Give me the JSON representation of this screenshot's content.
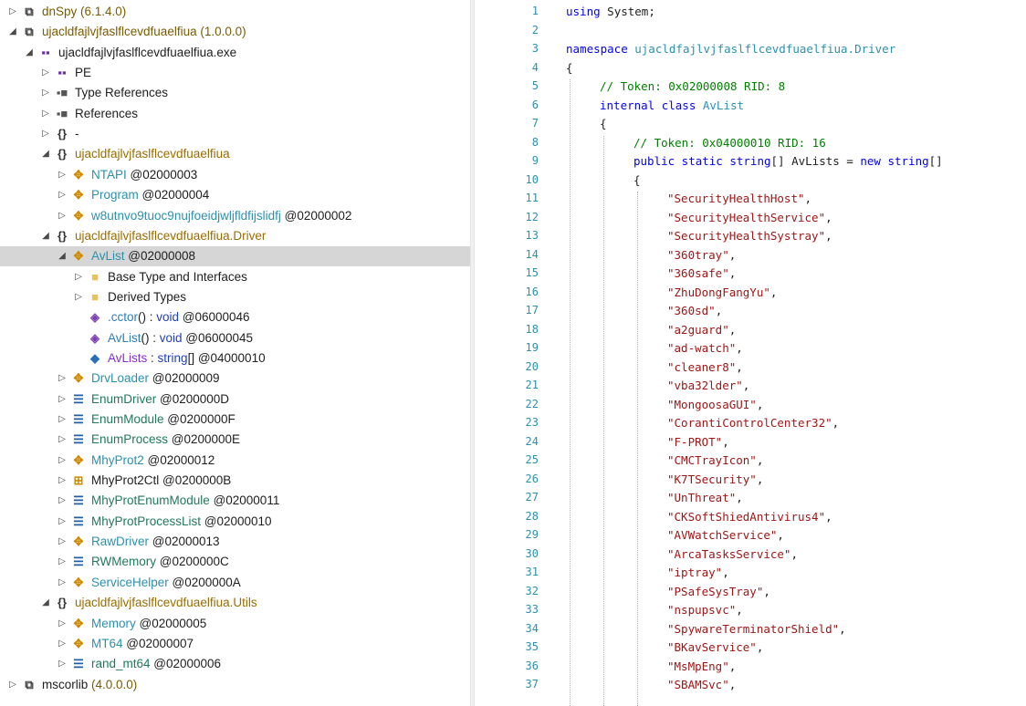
{
  "tree": {
    "nodes": [
      {
        "depth": 0,
        "exp": "collapsed",
        "icon": "assembly-icon",
        "glyph": "⧉",
        "icolor": "#3a3a3a",
        "parts": [
          {
            "t": "dnSpy",
            "c": "c-asm"
          },
          {
            "t": " (6.1.4.0)",
            "c": "c-ver"
          }
        ]
      },
      {
        "depth": 0,
        "exp": "expanded",
        "icon": "assembly-icon",
        "glyph": "⧉",
        "icolor": "#3a3a3a",
        "parts": [
          {
            "t": "ujacldfajlvjfaslflcevdfuaelfiua",
            "c": "c-asm"
          },
          {
            "t": " (1.0.0.0)",
            "c": "c-ver"
          }
        ]
      },
      {
        "depth": 1,
        "exp": "expanded",
        "icon": "module-icon",
        "glyph": "▪▪",
        "icolor": "#6b2fa0",
        "parts": [
          {
            "t": "ujacldfajlvjfaslflcevdfuaelfiua.exe",
            "c": "c-text"
          }
        ]
      },
      {
        "depth": 2,
        "exp": "collapsed",
        "icon": "pe-icon",
        "glyph": "▪▪",
        "icolor": "#6b2fa0",
        "parts": [
          {
            "t": "PE",
            "c": "c-text"
          }
        ]
      },
      {
        "depth": 2,
        "exp": "collapsed",
        "icon": "type-references-icon",
        "glyph": "▪■",
        "icolor": "#555555",
        "parts": [
          {
            "t": "Type References",
            "c": "c-text"
          }
        ]
      },
      {
        "depth": 2,
        "exp": "collapsed",
        "icon": "references-icon",
        "glyph": "▪■",
        "icolor": "#555555",
        "parts": [
          {
            "t": "References",
            "c": "c-text"
          }
        ]
      },
      {
        "depth": 2,
        "exp": "collapsed",
        "icon": "namespace-icon",
        "glyph": "{}",
        "icolor": "#333333",
        "parts": [
          {
            "t": "-",
            "c": "c-text"
          }
        ]
      },
      {
        "depth": 2,
        "exp": "expanded",
        "icon": "namespace-icon",
        "glyph": "{}",
        "icolor": "#333333",
        "parts": [
          {
            "t": "ujacldfajlvjfaslflcevdfuaelfiua",
            "c": "c-ns"
          }
        ]
      },
      {
        "depth": 3,
        "exp": "collapsed",
        "icon": "class-icon",
        "glyph": "✥",
        "icolor": "#d08a00",
        "parts": [
          {
            "t": "NTAPI",
            "c": "c-class"
          },
          {
            "t": " @02000003",
            "c": "addr"
          }
        ]
      },
      {
        "depth": 3,
        "exp": "collapsed",
        "icon": "class-icon",
        "glyph": "✥",
        "icolor": "#d08a00",
        "parts": [
          {
            "t": "Program",
            "c": "c-class"
          },
          {
            "t": " @02000004",
            "c": "addr"
          }
        ]
      },
      {
        "depth": 3,
        "exp": "collapsed",
        "icon": "class-icon",
        "glyph": "✥",
        "icolor": "#d08a00",
        "parts": [
          {
            "t": "w8utnvo9tuoc9nujfoeidjwljfldfijslidfj",
            "c": "c-class"
          },
          {
            "t": " @02000002",
            "c": "addr"
          }
        ]
      },
      {
        "depth": 2,
        "exp": "expanded",
        "icon": "namespace-icon",
        "glyph": "{}",
        "icolor": "#333333",
        "parts": [
          {
            "t": "ujacldfajlvjfaslflcevdfuaelfiua.Driver",
            "c": "c-ns"
          }
        ]
      },
      {
        "depth": 3,
        "exp": "expanded",
        "icon": "class-icon",
        "glyph": "✥",
        "icolor": "#d08a00",
        "selected": true,
        "parts": [
          {
            "t": "AvList",
            "c": "c-class"
          },
          {
            "t": " @02000008",
            "c": "addr"
          }
        ]
      },
      {
        "depth": 4,
        "exp": "collapsed",
        "icon": "folder-icon",
        "glyph": "■",
        "icolor": "#e8c25a",
        "parts": [
          {
            "t": "Base Type and Interfaces",
            "c": "c-text"
          }
        ]
      },
      {
        "depth": 4,
        "exp": "collapsed",
        "icon": "folder-icon",
        "glyph": "■",
        "icolor": "#e8c25a",
        "parts": [
          {
            "t": "Derived Types",
            "c": "c-text"
          }
        ]
      },
      {
        "depth": 4,
        "exp": "none",
        "icon": "static-method-icon",
        "glyph": "◈",
        "icolor": "#7a3fb0",
        "parts": [
          {
            "t": ".cctor",
            "c": "c-method"
          },
          {
            "t": "() : ",
            "c": "c-text"
          },
          {
            "t": "void",
            "c": "c-void"
          },
          {
            "t": " @06000046",
            "c": "addr"
          }
        ]
      },
      {
        "depth": 4,
        "exp": "none",
        "icon": "method-icon",
        "glyph": "◈",
        "icolor": "#7a3fb0",
        "parts": [
          {
            "t": "AvList",
            "c": "c-method"
          },
          {
            "t": "() : ",
            "c": "c-text"
          },
          {
            "t": "void",
            "c": "c-void"
          },
          {
            "t": " @06000045",
            "c": "addr"
          }
        ]
      },
      {
        "depth": 4,
        "exp": "none",
        "icon": "field-icon",
        "glyph": "◆",
        "icolor": "#2a6fb8",
        "parts": [
          {
            "t": "AvLists",
            "c": "c-field"
          },
          {
            "t": " : ",
            "c": "c-text"
          },
          {
            "t": "string",
            "c": "c-void"
          },
          {
            "t": "[] @04000010",
            "c": "addr"
          }
        ]
      },
      {
        "depth": 3,
        "exp": "collapsed",
        "icon": "class-icon",
        "glyph": "✥",
        "icolor": "#d08a00",
        "parts": [
          {
            "t": "DrvLoader",
            "c": "c-class"
          },
          {
            "t": " @02000009",
            "c": "addr"
          }
        ]
      },
      {
        "depth": 3,
        "exp": "collapsed",
        "icon": "enum-icon",
        "glyph": "☰",
        "icolor": "#1f5fa8",
        "parts": [
          {
            "t": "EnumDriver",
            "c": "c-enum"
          },
          {
            "t": " @0200000D",
            "c": "addr"
          }
        ]
      },
      {
        "depth": 3,
        "exp": "collapsed",
        "icon": "enum-icon",
        "glyph": "☰",
        "icolor": "#1f5fa8",
        "parts": [
          {
            "t": "EnumModule",
            "c": "c-enum"
          },
          {
            "t": " @0200000F",
            "c": "addr"
          }
        ]
      },
      {
        "depth": 3,
        "exp": "collapsed",
        "icon": "enum-icon",
        "glyph": "☰",
        "icolor": "#1f5fa8",
        "parts": [
          {
            "t": "EnumProcess",
            "c": "c-enum"
          },
          {
            "t": " @0200000E",
            "c": "addr"
          }
        ]
      },
      {
        "depth": 3,
        "exp": "collapsed",
        "icon": "class-icon",
        "glyph": "✥",
        "icolor": "#d08a00",
        "parts": [
          {
            "t": "MhyProt2",
            "c": "c-class"
          },
          {
            "t": " @02000012",
            "c": "addr"
          }
        ]
      },
      {
        "depth": 3,
        "exp": "collapsed",
        "icon": "control-class-icon",
        "glyph": "⊞",
        "icolor": "#d08a00",
        "parts": [
          {
            "t": "MhyProt2Ctl",
            "c": "c-text"
          },
          {
            "t": " @0200000B",
            "c": "addr"
          }
        ]
      },
      {
        "depth": 3,
        "exp": "collapsed",
        "icon": "enum-icon",
        "glyph": "☰",
        "icolor": "#1f5fa8",
        "parts": [
          {
            "t": "MhyProtEnumModule",
            "c": "c-enum"
          },
          {
            "t": " @02000011",
            "c": "addr"
          }
        ]
      },
      {
        "depth": 3,
        "exp": "collapsed",
        "icon": "enum-icon",
        "glyph": "☰",
        "icolor": "#1f5fa8",
        "parts": [
          {
            "t": "MhyProtProcessList",
            "c": "c-enum"
          },
          {
            "t": " @02000010",
            "c": "addr"
          }
        ]
      },
      {
        "depth": 3,
        "exp": "collapsed",
        "icon": "class-icon",
        "glyph": "✥",
        "icolor": "#d08a00",
        "parts": [
          {
            "t": "RawDriver",
            "c": "c-class"
          },
          {
            "t": " @02000013",
            "c": "addr"
          }
        ]
      },
      {
        "depth": 3,
        "exp": "collapsed",
        "icon": "enum-icon",
        "glyph": "☰",
        "icolor": "#1f5fa8",
        "parts": [
          {
            "t": "RWMemory",
            "c": "c-enum"
          },
          {
            "t": " @0200000C",
            "c": "addr"
          }
        ]
      },
      {
        "depth": 3,
        "exp": "collapsed",
        "icon": "class-icon",
        "glyph": "✥",
        "icolor": "#d08a00",
        "parts": [
          {
            "t": "ServiceHelper",
            "c": "c-class"
          },
          {
            "t": " @0200000A",
            "c": "addr"
          }
        ]
      },
      {
        "depth": 2,
        "exp": "expanded",
        "icon": "namespace-icon",
        "glyph": "{}",
        "icolor": "#333333",
        "parts": [
          {
            "t": "ujacldfajlvjfaslflcevdfuaelfiua.Utils",
            "c": "c-ns"
          }
        ]
      },
      {
        "depth": 3,
        "exp": "collapsed",
        "icon": "class-icon",
        "glyph": "✥",
        "icolor": "#d08a00",
        "parts": [
          {
            "t": "Memory",
            "c": "c-class"
          },
          {
            "t": " @02000005",
            "c": "addr"
          }
        ]
      },
      {
        "depth": 3,
        "exp": "collapsed",
        "icon": "class-icon",
        "glyph": "✥",
        "icolor": "#d08a00",
        "parts": [
          {
            "t": "MT64",
            "c": "c-class"
          },
          {
            "t": " @02000007",
            "c": "addr"
          }
        ]
      },
      {
        "depth": 3,
        "exp": "collapsed",
        "icon": "enum-icon",
        "glyph": "☰",
        "icolor": "#1f5fa8",
        "parts": [
          {
            "t": "rand_mt64",
            "c": "c-enum"
          },
          {
            "t": " @02000006",
            "c": "addr"
          }
        ]
      },
      {
        "depth": 0,
        "exp": "collapsed",
        "icon": "assembly-icon",
        "glyph": "⧉",
        "icolor": "#3a3a3a",
        "parts": [
          {
            "t": "mscorlib",
            "c": "c-text"
          },
          {
            "t": " (4.0.0.0)",
            "c": "c-ver"
          }
        ]
      }
    ]
  },
  "editor": {
    "lines": [
      {
        "n": "1",
        "indent": 0,
        "parts": [
          {
            "t": "using",
            "c": "k"
          },
          {
            "t": " System;",
            "c": ""
          }
        ]
      },
      {
        "n": "2",
        "indent": 0,
        "parts": []
      },
      {
        "n": "3",
        "indent": 0,
        "parts": [
          {
            "t": "namespace",
            "c": "k"
          },
          {
            "t": " ujacldfajlvjfaslflcevdfuaelfiua.Driver",
            "c": "tn"
          }
        ]
      },
      {
        "n": "4",
        "indent": 0,
        "parts": [
          {
            "t": "{",
            "c": ""
          }
        ]
      },
      {
        "n": "5",
        "indent": 1,
        "parts": [
          {
            "t": "// Token: 0x02000008 RID: 8",
            "c": "cm"
          }
        ]
      },
      {
        "n": "6",
        "indent": 1,
        "parts": [
          {
            "t": "internal class",
            "c": "k"
          },
          {
            "t": " AvList",
            "c": "tn"
          }
        ]
      },
      {
        "n": "7",
        "indent": 1,
        "parts": [
          {
            "t": "{",
            "c": ""
          }
        ]
      },
      {
        "n": "8",
        "indent": 2,
        "parts": [
          {
            "t": "// Token: 0x04000010 RID: 16",
            "c": "cm"
          }
        ]
      },
      {
        "n": "9",
        "indent": 2,
        "parts": [
          {
            "t": "public static string",
            "c": "k"
          },
          {
            "t": "[] AvLists = ",
            "c": ""
          },
          {
            "t": "new string",
            "c": "k"
          },
          {
            "t": "[]",
            "c": ""
          }
        ]
      },
      {
        "n": "10",
        "indent": 2,
        "parts": [
          {
            "t": "{",
            "c": ""
          }
        ]
      },
      {
        "n": "11",
        "indent": 3,
        "parts": [
          {
            "t": "\"SecurityHealthHost\"",
            "c": "st"
          },
          {
            "t": ",",
            "c": ""
          }
        ]
      },
      {
        "n": "12",
        "indent": 3,
        "parts": [
          {
            "t": "\"SecurityHealthService\"",
            "c": "st"
          },
          {
            "t": ",",
            "c": ""
          }
        ]
      },
      {
        "n": "13",
        "indent": 3,
        "parts": [
          {
            "t": "\"SecurityHealthSystray\"",
            "c": "st"
          },
          {
            "t": ",",
            "c": ""
          }
        ]
      },
      {
        "n": "14",
        "indent": 3,
        "parts": [
          {
            "t": "\"360tray\"",
            "c": "st"
          },
          {
            "t": ",",
            "c": ""
          }
        ]
      },
      {
        "n": "15",
        "indent": 3,
        "parts": [
          {
            "t": "\"360safe\"",
            "c": "st"
          },
          {
            "t": ",",
            "c": ""
          }
        ]
      },
      {
        "n": "16",
        "indent": 3,
        "parts": [
          {
            "t": "\"ZhuDongFangYu\"",
            "c": "st"
          },
          {
            "t": ",",
            "c": ""
          }
        ]
      },
      {
        "n": "17",
        "indent": 3,
        "parts": [
          {
            "t": "\"360sd\"",
            "c": "st"
          },
          {
            "t": ",",
            "c": ""
          }
        ]
      },
      {
        "n": "18",
        "indent": 3,
        "parts": [
          {
            "t": "\"a2guard\"",
            "c": "st"
          },
          {
            "t": ",",
            "c": ""
          }
        ]
      },
      {
        "n": "19",
        "indent": 3,
        "parts": [
          {
            "t": "\"ad-watch\"",
            "c": "st"
          },
          {
            "t": ",",
            "c": ""
          }
        ]
      },
      {
        "n": "20",
        "indent": 3,
        "parts": [
          {
            "t": "\"cleaner8\"",
            "c": "st"
          },
          {
            "t": ",",
            "c": ""
          }
        ]
      },
      {
        "n": "21",
        "indent": 3,
        "parts": [
          {
            "t": "\"vba32lder\"",
            "c": "st"
          },
          {
            "t": ",",
            "c": ""
          }
        ]
      },
      {
        "n": "22",
        "indent": 3,
        "parts": [
          {
            "t": "\"MongoosaGUI\"",
            "c": "st"
          },
          {
            "t": ",",
            "c": ""
          }
        ]
      },
      {
        "n": "23",
        "indent": 3,
        "parts": [
          {
            "t": "\"CorantiControlCenter32\"",
            "c": "st"
          },
          {
            "t": ",",
            "c": ""
          }
        ]
      },
      {
        "n": "24",
        "indent": 3,
        "parts": [
          {
            "t": "\"F-PROT\"",
            "c": "st"
          },
          {
            "t": ",",
            "c": ""
          }
        ]
      },
      {
        "n": "25",
        "indent": 3,
        "parts": [
          {
            "t": "\"CMCTrayIcon\"",
            "c": "st"
          },
          {
            "t": ",",
            "c": ""
          }
        ]
      },
      {
        "n": "26",
        "indent": 3,
        "parts": [
          {
            "t": "\"K7TSecurity\"",
            "c": "st"
          },
          {
            "t": ",",
            "c": ""
          }
        ]
      },
      {
        "n": "27",
        "indent": 3,
        "parts": [
          {
            "t": "\"UnThreat\"",
            "c": "st"
          },
          {
            "t": ",",
            "c": ""
          }
        ]
      },
      {
        "n": "28",
        "indent": 3,
        "parts": [
          {
            "t": "\"CKSoftShiedAntivirus4\"",
            "c": "st"
          },
          {
            "t": ",",
            "c": ""
          }
        ]
      },
      {
        "n": "29",
        "indent": 3,
        "parts": [
          {
            "t": "\"AVWatchService\"",
            "c": "st"
          },
          {
            "t": ",",
            "c": ""
          }
        ]
      },
      {
        "n": "30",
        "indent": 3,
        "parts": [
          {
            "t": "\"ArcaTasksService\"",
            "c": "st"
          },
          {
            "t": ",",
            "c": ""
          }
        ]
      },
      {
        "n": "31",
        "indent": 3,
        "parts": [
          {
            "t": "\"iptray\"",
            "c": "st"
          },
          {
            "t": ",",
            "c": ""
          }
        ]
      },
      {
        "n": "32",
        "indent": 3,
        "parts": [
          {
            "t": "\"PSafeSysTray\"",
            "c": "st"
          },
          {
            "t": ",",
            "c": ""
          }
        ]
      },
      {
        "n": "33",
        "indent": 3,
        "parts": [
          {
            "t": "\"nspupsvc\"",
            "c": "st"
          },
          {
            "t": ",",
            "c": ""
          }
        ]
      },
      {
        "n": "34",
        "indent": 3,
        "parts": [
          {
            "t": "\"SpywareTerminatorShield\"",
            "c": "st"
          },
          {
            "t": ",",
            "c": ""
          }
        ]
      },
      {
        "n": "35",
        "indent": 3,
        "parts": [
          {
            "t": "\"BKavService\"",
            "c": "st"
          },
          {
            "t": ",",
            "c": ""
          }
        ]
      },
      {
        "n": "36",
        "indent": 3,
        "parts": [
          {
            "t": "\"MsMpEng\"",
            "c": "st"
          },
          {
            "t": ",",
            "c": ""
          }
        ]
      },
      {
        "n": "37",
        "indent": 3,
        "parts": [
          {
            "t": "\"SBAMSvc\"",
            "c": "st"
          },
          {
            "t": ",",
            "c": ""
          }
        ]
      }
    ]
  }
}
